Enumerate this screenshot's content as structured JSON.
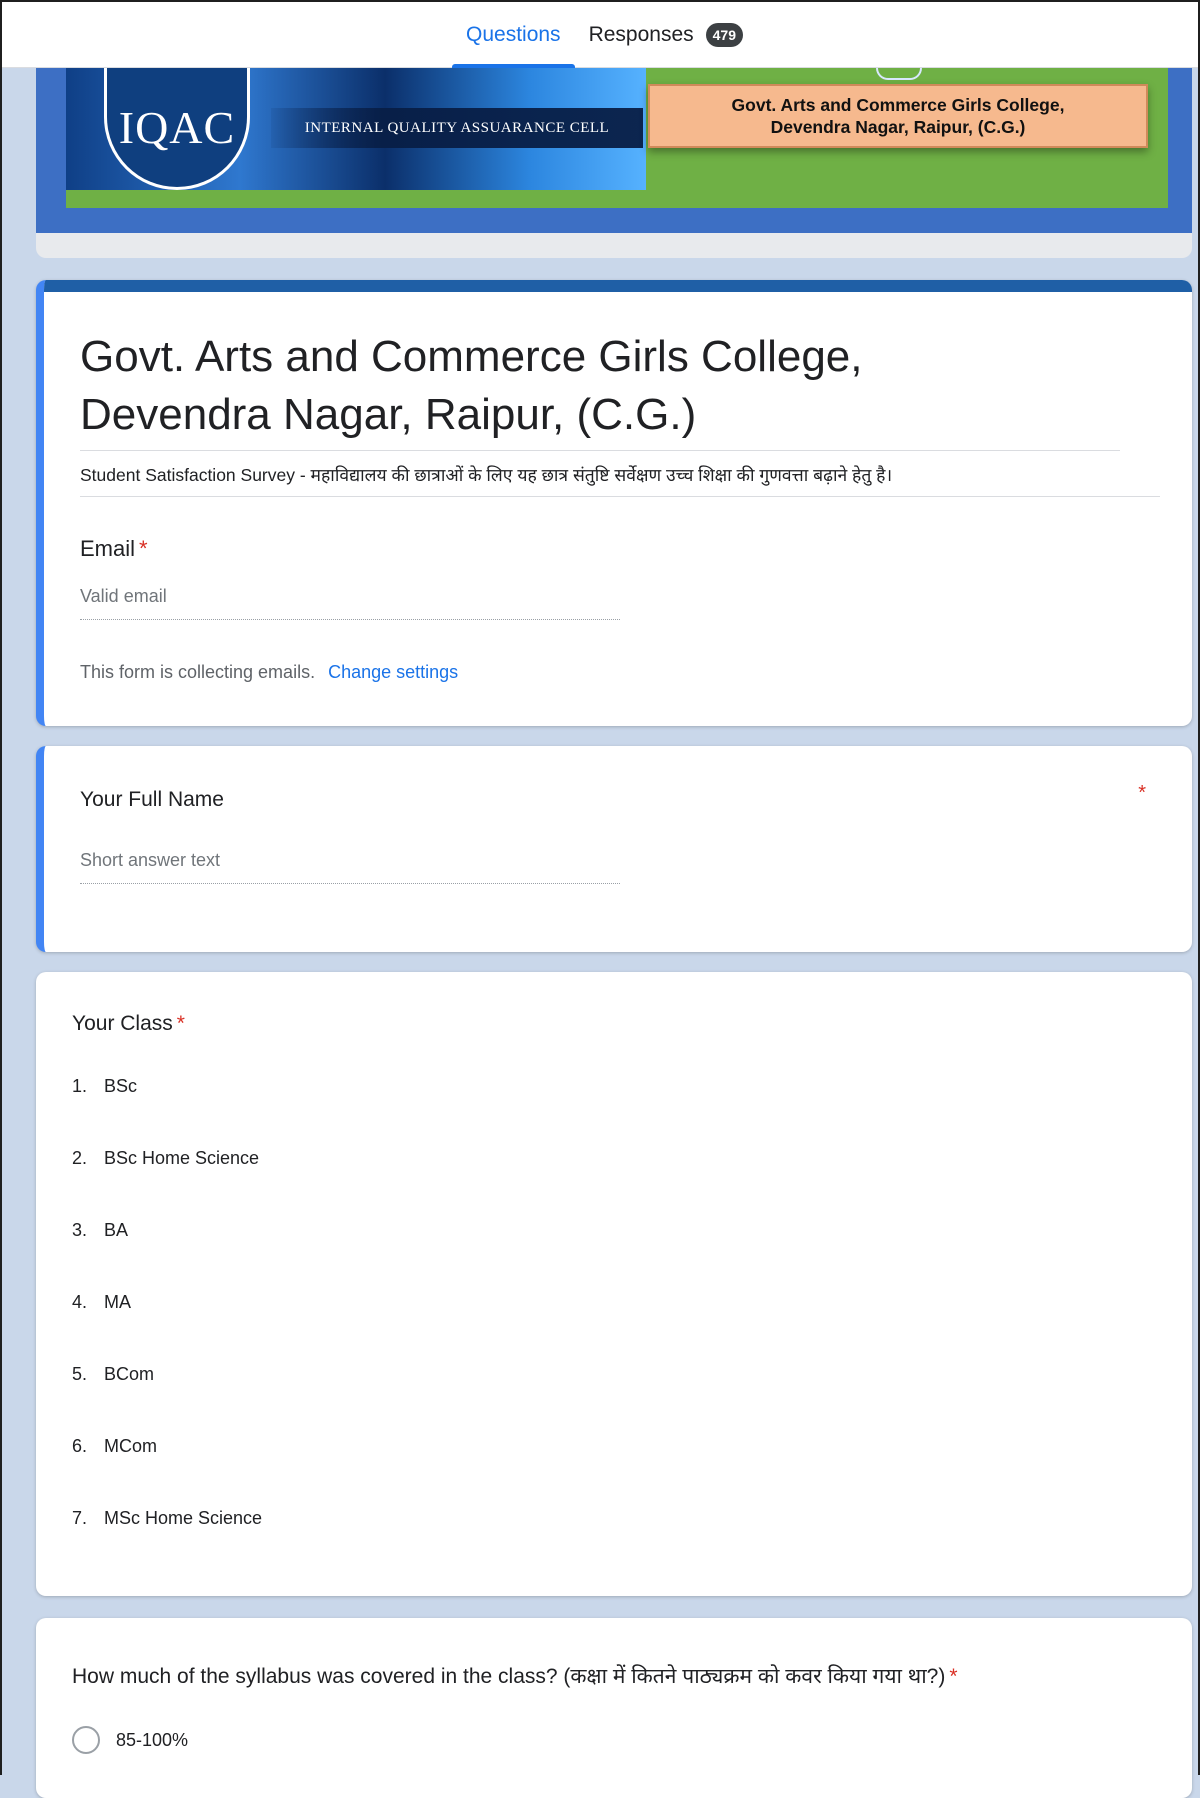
{
  "tabs": {
    "questions": "Questions",
    "responses": "Responses",
    "responses_count": "479"
  },
  "banner": {
    "logo_text": "IQAC",
    "strip_text": "INTERNAL QUALITY ASSUARANCE CELL",
    "college_line1": "Govt. Arts and Commerce Girls College,",
    "college_line2": "Devendra Nagar, Raipur, (C.G.)"
  },
  "form": {
    "title_line1": "Govt. Arts and Commerce Girls College,",
    "title_line2": "Devendra Nagar, Raipur, (C.G.)",
    "description": "Student Satisfaction Survey - महाविद्यालय की छात्राओं के लिए यह छात्र संतुष्टि सर्वेक्षण उच्च शिक्षा की गुणवत्ता बढ़ाने हेतु है।",
    "email_label": "Email",
    "email_placeholder": "Valid email",
    "collecting_note": "This form is collecting emails.",
    "change_settings": "Change settings",
    "required_mark": "*"
  },
  "questions": {
    "full_name": {
      "title": "Your Full Name",
      "placeholder": "Short answer text"
    },
    "class": {
      "title": "Your Class",
      "options": [
        {
          "num": "1.",
          "label": "BSc"
        },
        {
          "num": "2.",
          "label": "BSc Home Science"
        },
        {
          "num": "3.",
          "label": "BA"
        },
        {
          "num": "4.",
          "label": "MA"
        },
        {
          "num": "5.",
          "label": "BCom"
        },
        {
          "num": "6.",
          "label": "MCom"
        },
        {
          "num": "7.",
          "label": "MSc Home Science"
        }
      ]
    },
    "syllabus": {
      "title": "How much of the syllabus was covered in the class? (कक्षा में कितने पाठ्यक्रम को कवर किया गया था?)",
      "options": [
        "85-100%"
      ]
    }
  },
  "colors": {
    "accent": "#1a73e8",
    "required": "#d93025",
    "active_border": "#4285f4",
    "title_strip": "#1f5fa6",
    "banner_green": "#6fb045",
    "banner_blue": "#3d6fc4",
    "college_box": "#f6b98e"
  }
}
